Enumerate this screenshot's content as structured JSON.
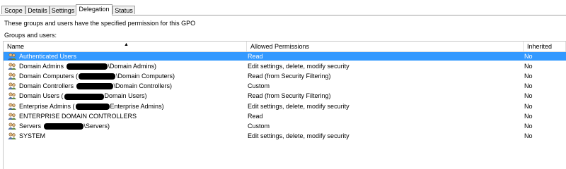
{
  "tabs": [
    {
      "label": "Scope",
      "active": false
    },
    {
      "label": "Details",
      "active": false
    },
    {
      "label": "Settings",
      "active": false
    },
    {
      "label": "Delegation",
      "active": true
    },
    {
      "label": "Status",
      "active": false
    }
  ],
  "description": "These groups and users have the specified permission for this GPO",
  "groups_label": "Groups and users:",
  "columns": {
    "name": "Name",
    "permissions": "Allowed Permissions",
    "inherited": "Inherited"
  },
  "colors": {
    "selection": "#3399ff",
    "redaction": "#000000"
  },
  "rows": [
    {
      "name": "Authenticated Users",
      "permission": "Read",
      "inherited": "No",
      "selected": true
    },
    {
      "name_prefix": "Domain Admins ",
      "name_suffix": "\\Domain Admins)",
      "redacted": true,
      "permission": "Edit settings, delete, modify security",
      "inherited": "No"
    },
    {
      "name_prefix": "Domain Computers (",
      "name_suffix": "\\Domain Computers)",
      "redacted": true,
      "permission": "Read (from Security Filtering)",
      "inherited": "No"
    },
    {
      "name_prefix": "Domain Controllers ",
      "name_suffix": "\\Domain Controllers)",
      "redacted": true,
      "permission": "Custom",
      "inherited": "No"
    },
    {
      "name_prefix": "Domain Users (",
      "name_suffix": "Domain Users)",
      "redacted": true,
      "permission": "Read (from Security Filtering)",
      "inherited": "No"
    },
    {
      "name_prefix": "Enterprise Admins (",
      "name_suffix": "Enterprise Admins)",
      "redacted": true,
      "permission": "Edit settings, delete, modify security",
      "inherited": "No"
    },
    {
      "name": "ENTERPRISE DOMAIN CONTROLLERS",
      "permission": "Read",
      "inherited": "No"
    },
    {
      "name_prefix": "Servers ",
      "name_suffix": "\\Servers)",
      "redacted": true,
      "permission": "Custom",
      "inherited": "No"
    },
    {
      "name": "SYSTEM",
      "permission": "Edit settings, delete, modify security",
      "inherited": "No"
    }
  ]
}
